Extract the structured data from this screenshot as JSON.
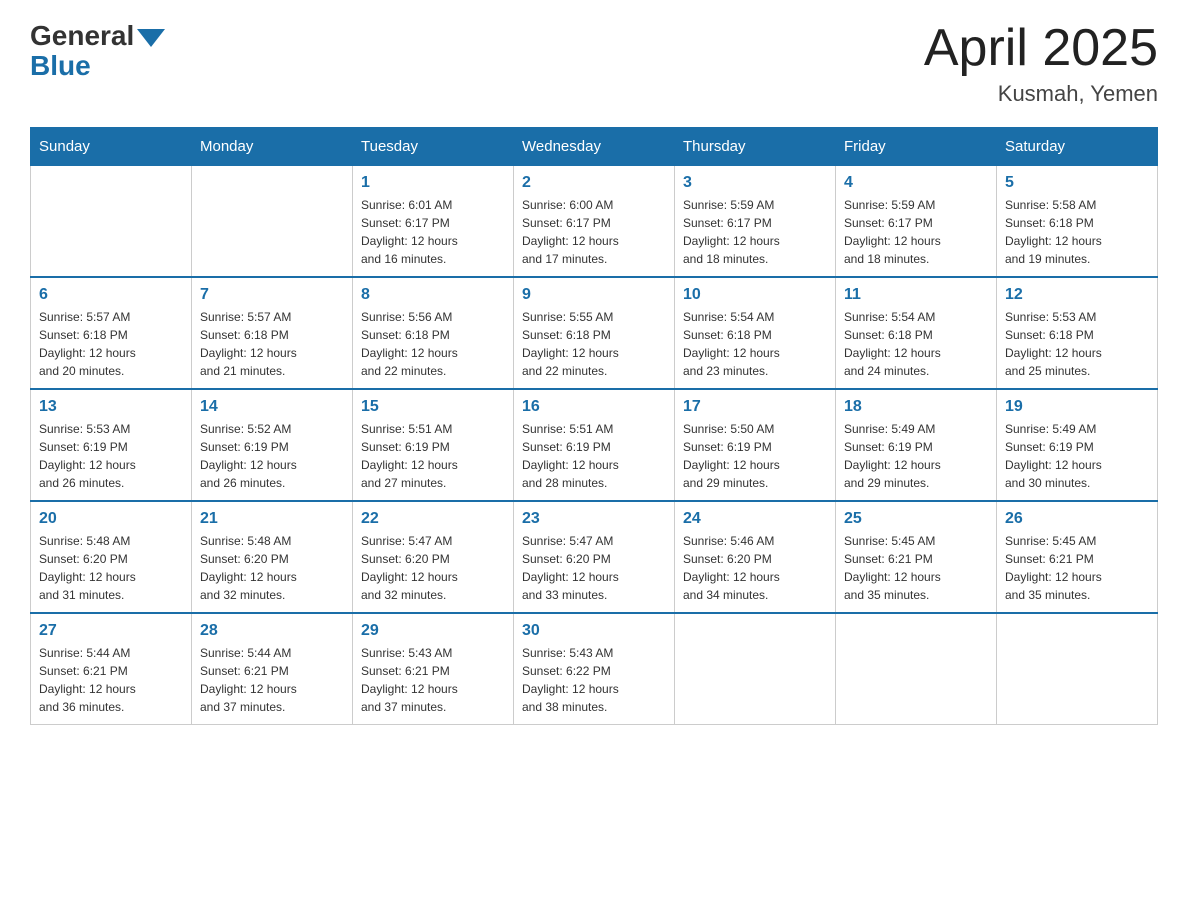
{
  "header": {
    "logo_general": "General",
    "logo_blue": "Blue",
    "title": "April 2025",
    "location": "Kusmah, Yemen"
  },
  "weekdays": [
    "Sunday",
    "Monday",
    "Tuesday",
    "Wednesday",
    "Thursday",
    "Friday",
    "Saturday"
  ],
  "weeks": [
    [
      {
        "day": "",
        "info": ""
      },
      {
        "day": "",
        "info": ""
      },
      {
        "day": "1",
        "info": "Sunrise: 6:01 AM\nSunset: 6:17 PM\nDaylight: 12 hours\nand 16 minutes."
      },
      {
        "day": "2",
        "info": "Sunrise: 6:00 AM\nSunset: 6:17 PM\nDaylight: 12 hours\nand 17 minutes."
      },
      {
        "day": "3",
        "info": "Sunrise: 5:59 AM\nSunset: 6:17 PM\nDaylight: 12 hours\nand 18 minutes."
      },
      {
        "day": "4",
        "info": "Sunrise: 5:59 AM\nSunset: 6:17 PM\nDaylight: 12 hours\nand 18 minutes."
      },
      {
        "day": "5",
        "info": "Sunrise: 5:58 AM\nSunset: 6:18 PM\nDaylight: 12 hours\nand 19 minutes."
      }
    ],
    [
      {
        "day": "6",
        "info": "Sunrise: 5:57 AM\nSunset: 6:18 PM\nDaylight: 12 hours\nand 20 minutes."
      },
      {
        "day": "7",
        "info": "Sunrise: 5:57 AM\nSunset: 6:18 PM\nDaylight: 12 hours\nand 21 minutes."
      },
      {
        "day": "8",
        "info": "Sunrise: 5:56 AM\nSunset: 6:18 PM\nDaylight: 12 hours\nand 22 minutes."
      },
      {
        "day": "9",
        "info": "Sunrise: 5:55 AM\nSunset: 6:18 PM\nDaylight: 12 hours\nand 22 minutes."
      },
      {
        "day": "10",
        "info": "Sunrise: 5:54 AM\nSunset: 6:18 PM\nDaylight: 12 hours\nand 23 minutes."
      },
      {
        "day": "11",
        "info": "Sunrise: 5:54 AM\nSunset: 6:18 PM\nDaylight: 12 hours\nand 24 minutes."
      },
      {
        "day": "12",
        "info": "Sunrise: 5:53 AM\nSunset: 6:18 PM\nDaylight: 12 hours\nand 25 minutes."
      }
    ],
    [
      {
        "day": "13",
        "info": "Sunrise: 5:53 AM\nSunset: 6:19 PM\nDaylight: 12 hours\nand 26 minutes."
      },
      {
        "day": "14",
        "info": "Sunrise: 5:52 AM\nSunset: 6:19 PM\nDaylight: 12 hours\nand 26 minutes."
      },
      {
        "day": "15",
        "info": "Sunrise: 5:51 AM\nSunset: 6:19 PM\nDaylight: 12 hours\nand 27 minutes."
      },
      {
        "day": "16",
        "info": "Sunrise: 5:51 AM\nSunset: 6:19 PM\nDaylight: 12 hours\nand 28 minutes."
      },
      {
        "day": "17",
        "info": "Sunrise: 5:50 AM\nSunset: 6:19 PM\nDaylight: 12 hours\nand 29 minutes."
      },
      {
        "day": "18",
        "info": "Sunrise: 5:49 AM\nSunset: 6:19 PM\nDaylight: 12 hours\nand 29 minutes."
      },
      {
        "day": "19",
        "info": "Sunrise: 5:49 AM\nSunset: 6:19 PM\nDaylight: 12 hours\nand 30 minutes."
      }
    ],
    [
      {
        "day": "20",
        "info": "Sunrise: 5:48 AM\nSunset: 6:20 PM\nDaylight: 12 hours\nand 31 minutes."
      },
      {
        "day": "21",
        "info": "Sunrise: 5:48 AM\nSunset: 6:20 PM\nDaylight: 12 hours\nand 32 minutes."
      },
      {
        "day": "22",
        "info": "Sunrise: 5:47 AM\nSunset: 6:20 PM\nDaylight: 12 hours\nand 32 minutes."
      },
      {
        "day": "23",
        "info": "Sunrise: 5:47 AM\nSunset: 6:20 PM\nDaylight: 12 hours\nand 33 minutes."
      },
      {
        "day": "24",
        "info": "Sunrise: 5:46 AM\nSunset: 6:20 PM\nDaylight: 12 hours\nand 34 minutes."
      },
      {
        "day": "25",
        "info": "Sunrise: 5:45 AM\nSunset: 6:21 PM\nDaylight: 12 hours\nand 35 minutes."
      },
      {
        "day": "26",
        "info": "Sunrise: 5:45 AM\nSunset: 6:21 PM\nDaylight: 12 hours\nand 35 minutes."
      }
    ],
    [
      {
        "day": "27",
        "info": "Sunrise: 5:44 AM\nSunset: 6:21 PM\nDaylight: 12 hours\nand 36 minutes."
      },
      {
        "day": "28",
        "info": "Sunrise: 5:44 AM\nSunset: 6:21 PM\nDaylight: 12 hours\nand 37 minutes."
      },
      {
        "day": "29",
        "info": "Sunrise: 5:43 AM\nSunset: 6:21 PM\nDaylight: 12 hours\nand 37 minutes."
      },
      {
        "day": "30",
        "info": "Sunrise: 5:43 AM\nSunset: 6:22 PM\nDaylight: 12 hours\nand 38 minutes."
      },
      {
        "day": "",
        "info": ""
      },
      {
        "day": "",
        "info": ""
      },
      {
        "day": "",
        "info": ""
      }
    ]
  ]
}
